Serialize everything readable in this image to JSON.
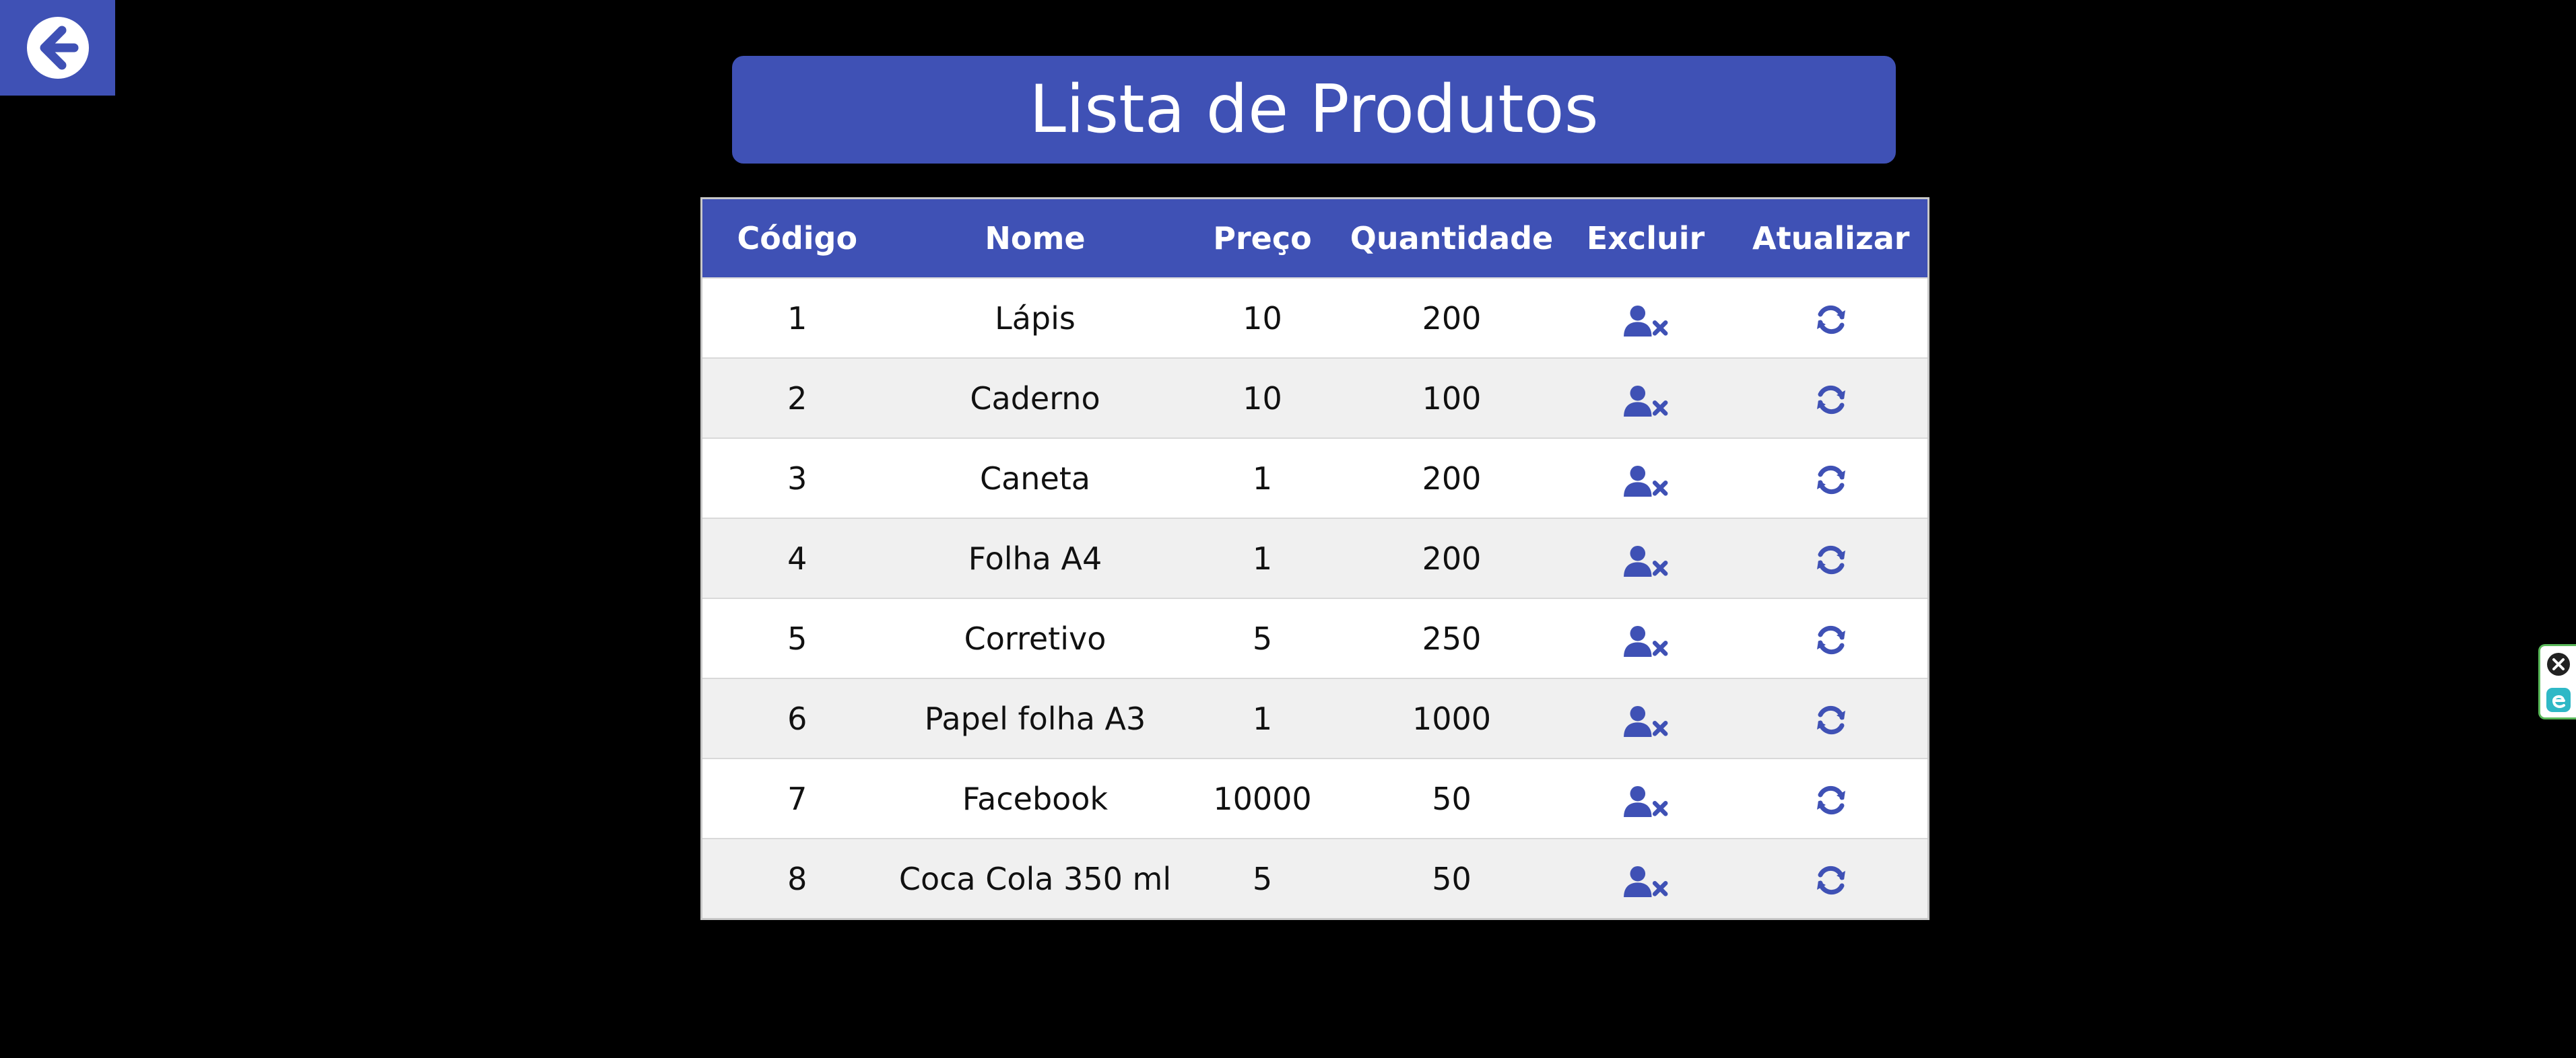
{
  "app": {
    "back_icon": "arrow-left-circle-icon"
  },
  "header": {
    "title": "Lista de Produtos"
  },
  "table": {
    "columns": [
      "Código",
      "Nome",
      "Preço",
      "Quantidade",
      "Excluir",
      "Atualizar"
    ],
    "rows": [
      {
        "codigo": "1",
        "nome": "Lápis",
        "preco": "10",
        "quantidade": "200"
      },
      {
        "codigo": "2",
        "nome": "Caderno",
        "preco": "10",
        "quantidade": "100"
      },
      {
        "codigo": "3",
        "nome": "Caneta",
        "preco": "1",
        "quantidade": "200"
      },
      {
        "codigo": "4",
        "nome": "Folha A4",
        "preco": "1",
        "quantidade": "200"
      },
      {
        "codigo": "5",
        "nome": "Corretivo",
        "preco": "5",
        "quantidade": "250"
      },
      {
        "codigo": "6",
        "nome": "Papel folha A3",
        "preco": "1",
        "quantidade": "1000"
      },
      {
        "codigo": "7",
        "nome": "Facebook",
        "preco": "10000",
        "quantidade": "50"
      },
      {
        "codigo": "8",
        "nome": "Coca Cola 350 ml",
        "preco": "5",
        "quantidade": "50"
      }
    ],
    "delete_icon": "user-times-icon",
    "update_icon": "refresh-icon"
  },
  "side_widget": {
    "icons": [
      "close-circle-icon",
      "edge-logo-icon"
    ]
  },
  "colors": {
    "accent": "#3f51b5",
    "background": "#000000",
    "row_alt": "#f0f0f0",
    "widget_border": "#5ab95a"
  }
}
